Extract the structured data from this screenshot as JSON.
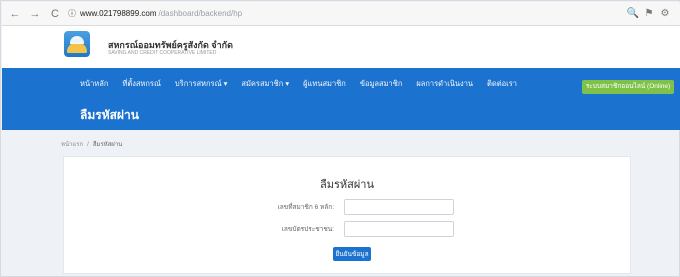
{
  "browser": {
    "back": "←",
    "forward": "→",
    "reload": "C",
    "url_host": "www.021798899.com",
    "url_path": "/dashboard/backend/hp",
    "actions": [
      "🔍",
      "⚑",
      "⚙"
    ]
  },
  "header": {
    "brand_title": "สหกรณ์ออมทรัพย์ครูสังกัด จำกัด",
    "brand_sub": "SAVING AND CREDIT COOPERATIVE LIMITED"
  },
  "menu": {
    "items": [
      "หน้าหลัก",
      "ที่ตั้งสหกรณ์",
      "บริการสหกรณ์ ▾",
      "สมัครสมาชิก ▾",
      "ผู้แทนสมาชิก",
      "ข้อมูลสมาชิก",
      "ผลการดำเนินงาน",
      "ติดต่อเรา"
    ],
    "cta": "ระบบสมาชิกออนไลน์ (Online)"
  },
  "page": {
    "title": "ลืมรหัสผ่าน",
    "breadcrumb": [
      "หน้าแรก",
      "ลืมรหัสผ่าน"
    ]
  },
  "form": {
    "heading": "ลืมรหัสผ่าน",
    "field1_label": "เลขที่สมาชิก 6 หลัก:",
    "field1_placeholder": "",
    "field2_label": "เลขบัตรประชาชน:",
    "field2_placeholder": "",
    "submit_label": "ยืนยันข้อมูล"
  },
  "colors": {
    "primary": "#1c73cf",
    "cta": "#7ec24a"
  }
}
